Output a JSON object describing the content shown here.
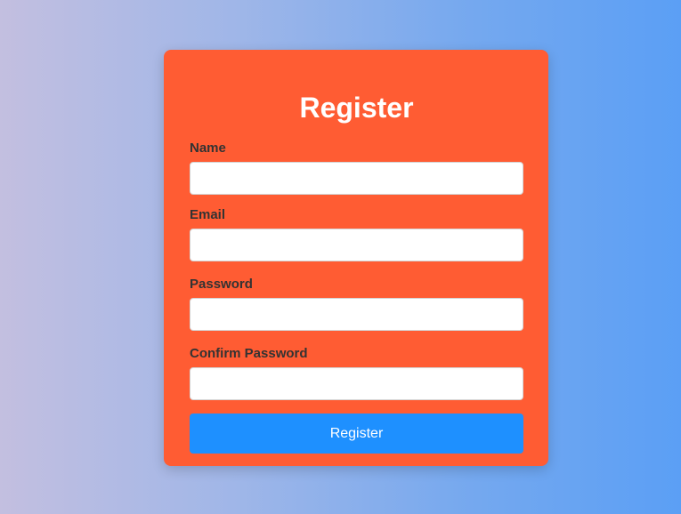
{
  "form": {
    "title": "Register",
    "fields": [
      {
        "label": "Name",
        "value": "",
        "placeholder": ""
      },
      {
        "label": "Email",
        "value": "",
        "placeholder": ""
      },
      {
        "label": "Password",
        "value": "",
        "placeholder": ""
      },
      {
        "label": "Confirm Password",
        "value": "",
        "placeholder": ""
      }
    ],
    "submit_label": "Register"
  },
  "colors": {
    "card_background": "#ff5c33",
    "submit_button": "#1e90ff",
    "label_text": "#333333",
    "background_gradient_start": "#c3bfe0",
    "background_gradient_end": "#5b9ff5"
  }
}
